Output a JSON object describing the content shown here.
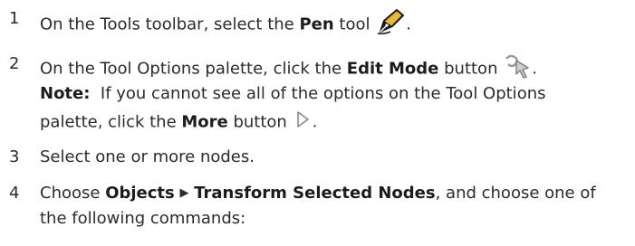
{
  "steps": [
    {
      "num": "1",
      "pre": "On the Tools toolbar, select the ",
      "bold": "Pen",
      "post": " tool",
      "end": ".",
      "icon": "pen-nib-icon"
    },
    {
      "num": "2",
      "pre": "On the Tool Options palette, click the ",
      "bold": "Edit Mode",
      "post": " button",
      "end": ".",
      "icon": "edit-mode-icon"
    },
    {
      "num": "3",
      "text": "Select one or more nodes."
    },
    {
      "num": "4",
      "pre": "Choose ",
      "menu1": "Objects",
      "arrow": "▶",
      "menu2": "Transform Selected Nodes",
      "post": ", and choose one of",
      "cont": "the following commands:"
    }
  ],
  "note": {
    "label": "Note:",
    "text1": "  If you cannot see all of the options on the Tool Options",
    "pre2": "palette, click the ",
    "bold": "More",
    "post2": " button",
    "end": ".",
    "icon": "more-arrow-icon"
  }
}
